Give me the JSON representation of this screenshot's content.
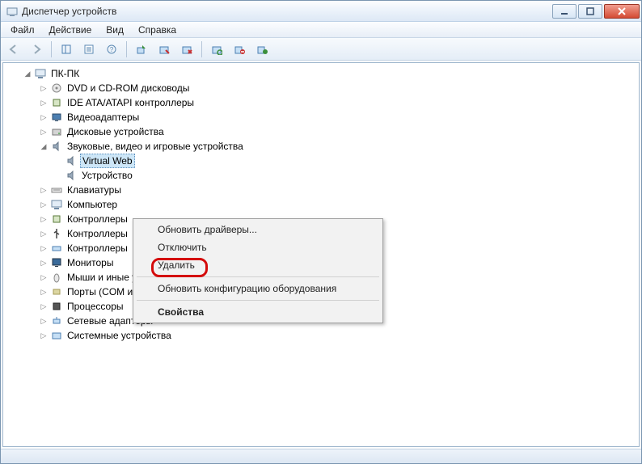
{
  "title": "Диспетчер устройств",
  "menu": {
    "file": "Файл",
    "action": "Действие",
    "view": "Вид",
    "help": "Справка"
  },
  "root": "ПК-ПК",
  "categories": [
    {
      "label": "DVD и CD-ROM дисководы",
      "icon": "disc"
    },
    {
      "label": "IDE ATA/ATAPI контроллеры",
      "icon": "chip"
    },
    {
      "label": "Видеоадаптеры",
      "icon": "display"
    },
    {
      "label": "Дисковые устройства",
      "icon": "hdd"
    },
    {
      "label": "Звуковые, видео и игровые устройства",
      "icon": "sound",
      "expanded": true,
      "children": [
        {
          "label": "Virtual Web",
          "icon": "sound",
          "selected": true
        },
        {
          "label": "Устройство",
          "icon": "sound"
        }
      ]
    },
    {
      "label": "Клавиатуры",
      "icon": "keyboard"
    },
    {
      "label": "Компьютер",
      "icon": "pc"
    },
    {
      "label": "Контроллеры",
      "icon": "chip"
    },
    {
      "label": "Контроллеры",
      "icon": "usb"
    },
    {
      "label": "Контроллеры",
      "icon": "bus"
    },
    {
      "label": "Мониторы",
      "icon": "monitor"
    },
    {
      "label": "Мыши и иные указывающие устройства",
      "icon": "mouse"
    },
    {
      "label": "Порты (COM и LPT)",
      "icon": "port"
    },
    {
      "label": "Процессоры",
      "icon": "cpu"
    },
    {
      "label": "Сетевые адаптеры",
      "icon": "net"
    },
    {
      "label": "Системные устройства",
      "icon": "sys"
    }
  ],
  "context": {
    "update": "Обновить драйверы...",
    "disable": "Отключить",
    "delete": "Удалить",
    "refresh": "Обновить конфигурацию оборудования",
    "props": "Свойства"
  }
}
